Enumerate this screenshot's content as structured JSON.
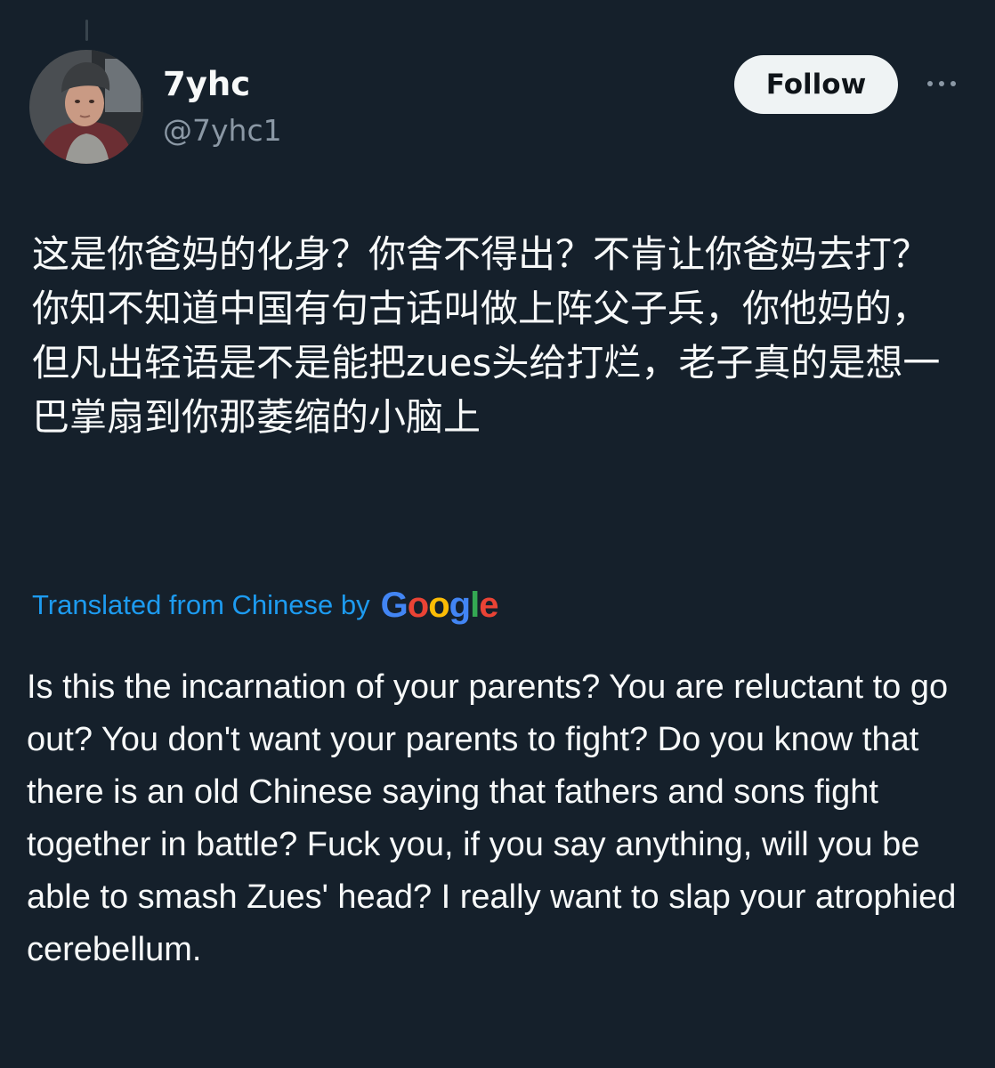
{
  "author": {
    "display_name": "7yhc",
    "handle": "@7yhc1",
    "avatar_icon": "profile-photo"
  },
  "actions": {
    "follow_label": "Follow",
    "more_icon": "more-options-icon"
  },
  "post": {
    "original_text": "这是你爸妈的化身？你舍不得出？不肯让你爸妈去打？你知不知道中国有句古话叫做上阵父子兵，你他妈的，但凡出轻语是不是能把zues头给打烂，老子真的是想一巴掌扇到你那萎缩的小脑上",
    "translation_label": "Translated from Chinese by",
    "translation_provider": {
      "letters": [
        "G",
        "o",
        "o",
        "g",
        "l",
        "e"
      ],
      "colors": [
        "#4285f4",
        "#ea4335",
        "#fbbc05",
        "#4285f4",
        "#34a853",
        "#ea4335"
      ]
    },
    "translated_text": "Is this the incarnation of your parents? You are reluctant to go out? You don't want your parents to fight? Do you know that there is an old Chinese saying that fathers and sons fight together in battle? Fuck you, if you say anything, will you be able to smash Zues' head? I really want to slap your atrophied cerebellum."
  },
  "colors": {
    "background": "#15202b",
    "text_primary": "#f7f9f9",
    "text_secondary": "#8b98a5",
    "link": "#1d9bf0",
    "follow_button_bg": "#eff3f4",
    "follow_button_text": "#0f1419"
  }
}
